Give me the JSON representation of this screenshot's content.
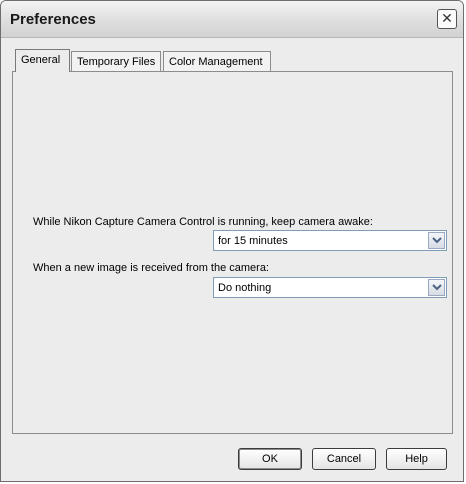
{
  "window": {
    "title": "Preferences",
    "close_glyph": "✕"
  },
  "tabs": [
    {
      "label": "General",
      "active": true
    },
    {
      "label": "Temporary Files",
      "active": false
    },
    {
      "label": "Color Management",
      "active": false
    }
  ],
  "general": {
    "keep_awake_label": "While Nikon Capture Camera Control is running, keep camera awake:",
    "keep_awake_value": "for 15 minutes",
    "new_image_label": "When a new image is received from the camera:",
    "new_image_value": "Do nothing"
  },
  "buttons": {
    "ok": "OK",
    "cancel": "Cancel",
    "help": "Help"
  },
  "icons": {
    "close": "close-icon",
    "dropdown": "chevron-down-icon"
  }
}
